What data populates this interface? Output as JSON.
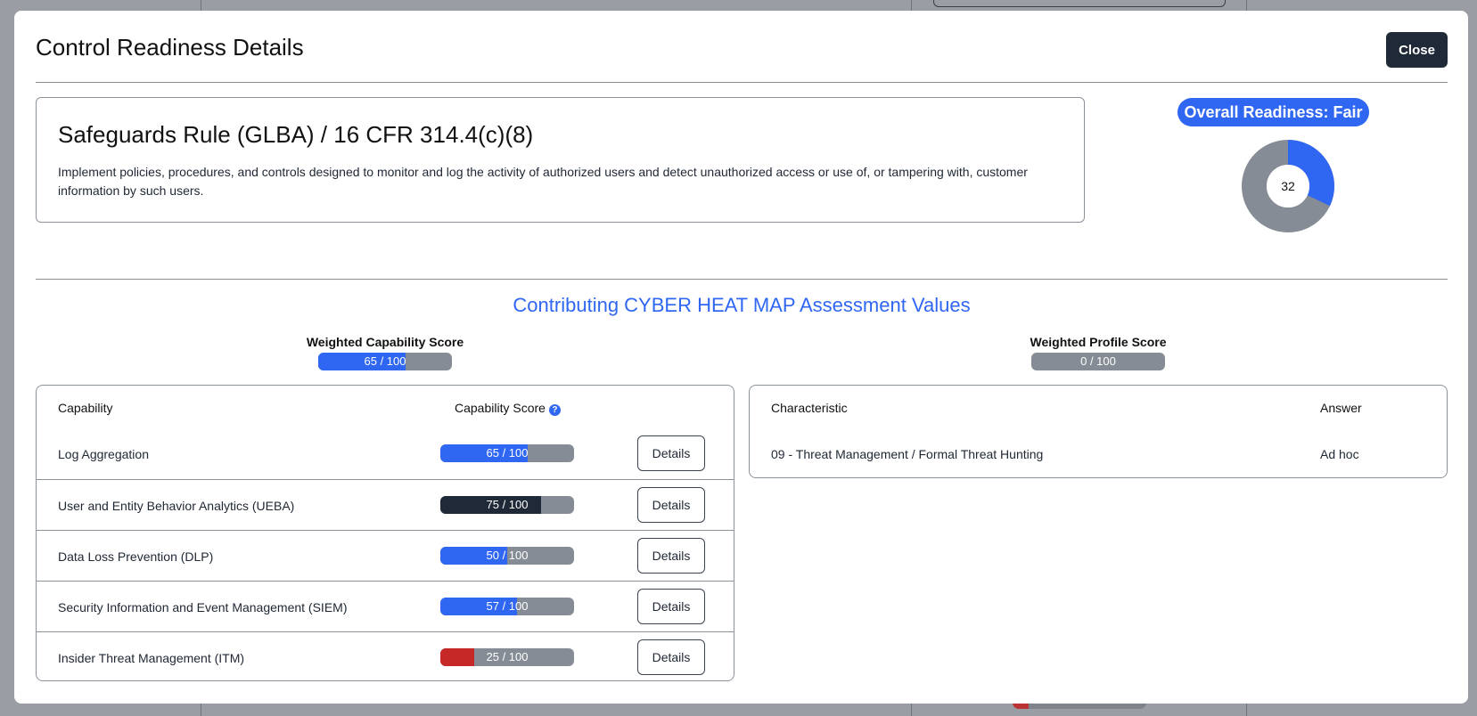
{
  "modal": {
    "title": "Control Readiness Details",
    "close_label": "Close"
  },
  "rule": {
    "title": "Safeguards Rule (GLBA) / 16 CFR 314.4(c)(8)",
    "description": "Implement policies, procedures, and controls designed to monitor and log the activity of authorized users and detect unauthorized access or use of, or tampering with, customer information by such users."
  },
  "overall": {
    "label": "Overall Readiness: Fair",
    "score": "32",
    "score_fraction": 0.32,
    "fill_color": "#2f66f2",
    "track_color": "#868c95"
  },
  "section_title": "Contributing CYBER HEAT MAP Assessment Values",
  "weighted_capability": {
    "label": "Weighted Capability Score",
    "value_text": "65 / 100",
    "fraction": 0.65,
    "color": "#2f66f2"
  },
  "weighted_profile": {
    "label": "Weighted Profile Score",
    "value_text": "0 / 100",
    "fraction": 0,
    "color": "#2f66f2"
  },
  "capability_table": {
    "headers": {
      "capability": "Capability",
      "score": "Capability Score"
    },
    "details_label": "Details",
    "rows": [
      {
        "name": "Log Aggregation",
        "score_text": "65 / 100",
        "fraction": 0.65,
        "color": "#2f66f2"
      },
      {
        "name": "User and Entity Behavior Analytics (UEBA)",
        "score_text": "75 / 100",
        "fraction": 0.75,
        "color": "#1f2937"
      },
      {
        "name": "Data Loss Prevention (DLP)",
        "score_text": "50 / 100",
        "fraction": 0.5,
        "color": "#2f66f2"
      },
      {
        "name": "Security Information and Event Management (SIEM)",
        "score_text": "57 / 100",
        "fraction": 0.57,
        "color": "#2f66f2"
      },
      {
        "name": "Insider Threat Management (ITM)",
        "score_text": "25 / 100",
        "fraction": 0.25,
        "color": "#c62828"
      }
    ]
  },
  "profile_table": {
    "headers": {
      "characteristic": "Characteristic",
      "answer": "Answer"
    },
    "rows": [
      {
        "characteristic": "09 - Threat Management / Formal Threat Hunting",
        "answer": "Ad hoc"
      }
    ]
  }
}
